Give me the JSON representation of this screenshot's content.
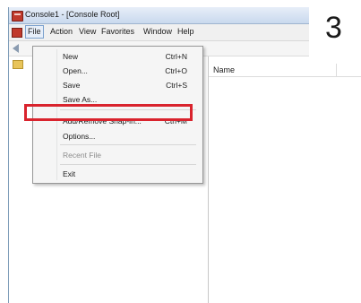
{
  "window": {
    "title": "Console1 - [Console Root]"
  },
  "menubar": {
    "items": [
      "File",
      "Action",
      "View",
      "Favorites",
      "Window",
      "Help"
    ]
  },
  "file_menu": {
    "items": [
      {
        "label": "New",
        "shortcut": "Ctrl+N",
        "enabled": true
      },
      {
        "label": "Open...",
        "shortcut": "Ctrl+O",
        "enabled": true
      },
      {
        "label": "Save",
        "shortcut": "Ctrl+S",
        "enabled": true
      },
      {
        "label": "Save As...",
        "shortcut": "",
        "enabled": true
      },
      {
        "label": "Add/Remove Snap-in...",
        "shortcut": "Ctrl+M",
        "enabled": true,
        "highlighted": true
      },
      {
        "label": "Options...",
        "shortcut": "",
        "enabled": true
      },
      {
        "label": "Recent File",
        "shortcut": "",
        "enabled": false
      },
      {
        "label": "Exit",
        "shortcut": "",
        "enabled": true
      }
    ]
  },
  "list_pane": {
    "columns": [
      "Name"
    ]
  },
  "annotation": {
    "step_number": "3",
    "highlight_color": "#d9232d"
  },
  "icons": [
    "app-icon",
    "back-arrow-icon",
    "folder-icon"
  ]
}
